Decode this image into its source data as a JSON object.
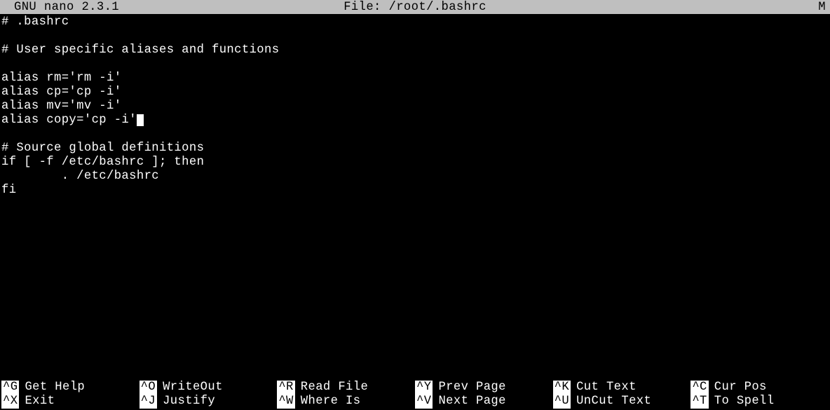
{
  "header": {
    "app_name": "GNU nano",
    "version": "2.3.1",
    "file_prefix": "File:",
    "file_path": "/root/.bashrc",
    "modified_flag": "M"
  },
  "file_lines": [
    "# .bashrc",
    "",
    "# User specific aliases and functions",
    "",
    "alias rm='rm -i'",
    "alias cp='cp -i'",
    "alias mv='mv -i'",
    "alias copy='cp -i'",
    "",
    "# Source global definitions",
    "if [ -f /etc/bashrc ]; then",
    "        . /etc/bashrc",
    "fi"
  ],
  "cursor_line": 7,
  "shortcuts": [
    {
      "key": "^G",
      "label": "Get Help"
    },
    {
      "key": "^X",
      "label": "Exit"
    },
    {
      "key": "^O",
      "label": "WriteOut"
    },
    {
      "key": "^J",
      "label": "Justify"
    },
    {
      "key": "^R",
      "label": "Read File"
    },
    {
      "key": "^W",
      "label": "Where Is"
    },
    {
      "key": "^Y",
      "label": "Prev Page"
    },
    {
      "key": "^V",
      "label": "Next Page"
    },
    {
      "key": "^K",
      "label": "Cut Text"
    },
    {
      "key": "^U",
      "label": "UnCut Text"
    },
    {
      "key": "^C",
      "label": "Cur Pos"
    },
    {
      "key": "^T",
      "label": "To Spell"
    }
  ]
}
